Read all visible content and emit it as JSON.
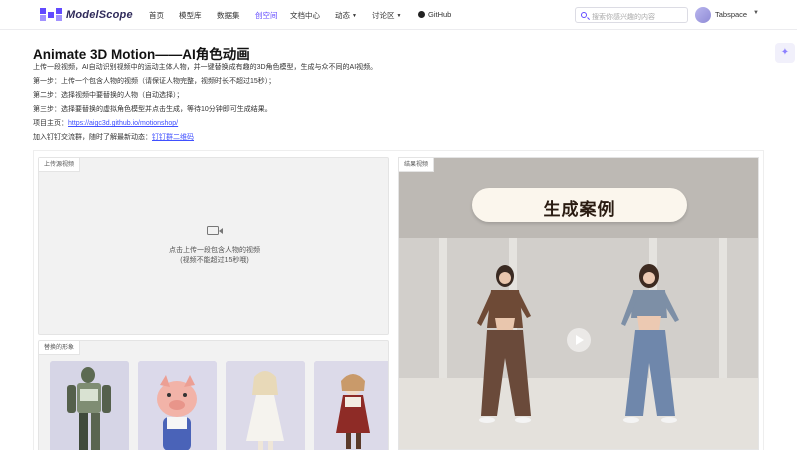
{
  "nav": {
    "logo_text": "ModelScope",
    "items": [
      "首页",
      "模型库",
      "数据集",
      "创空间",
      "文档中心",
      "动态",
      "讨论区",
      "GitHub"
    ],
    "search_placeholder": "搜索你感兴趣的内容",
    "username": "Tabspace"
  },
  "intro": {
    "title": "Animate 3D Motion——AI角色动画",
    "desc": "上传一段视频，AI自动识别视频中的运动主体人物，并一键替换成有趣的3D角色模型，生成与众不同的AI视频。",
    "step1": "第一步：上传一个包含人物的视频（请保证人物完整，视频时长不超过15秒）；",
    "step2": "第二步：选择视频中要替换的人物（自动选择）；",
    "step3": "第三步：选择要替换的虚拟角色模型并点击生成，等待10分钟即可生成结果。",
    "project_label": "项目主页：",
    "project_link": "https://aigc3d.github.io/motionshop/",
    "join_label": "加入钉钉交流群，随时了解最新动态：",
    "join_link": "钉钉群二维码"
  },
  "upload": {
    "tag": "上传源视频",
    "text1": "点击上传一段包含人物的视频",
    "text2": "(视频不能超过15秒哦)"
  },
  "characters": {
    "tag": "替换的形象"
  },
  "result": {
    "tag": "结果视频",
    "banner": "生成案例"
  },
  "colors": {
    "accent": "#624aff",
    "link": "#4050ff"
  }
}
